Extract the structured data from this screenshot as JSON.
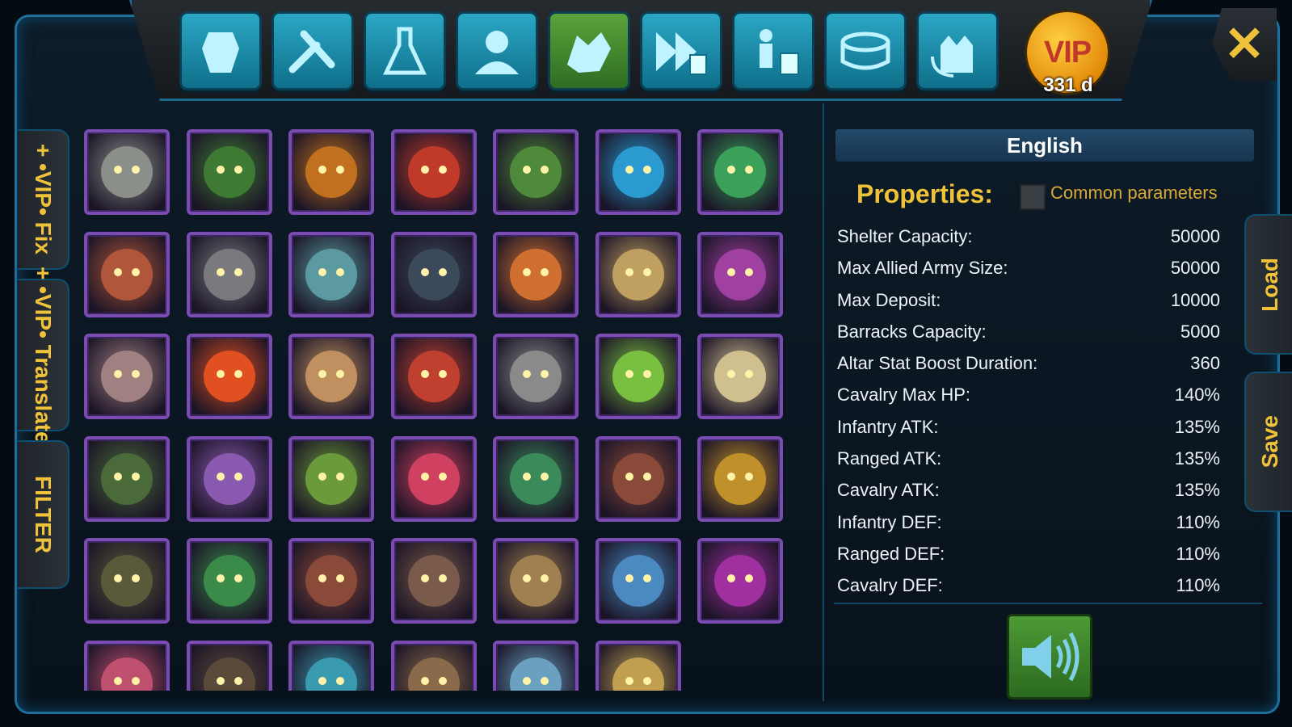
{
  "toolbar": {
    "buttons": [
      {
        "icon": "armor-icon",
        "active": false
      },
      {
        "icon": "tools-icon",
        "active": false
      },
      {
        "icon": "flask-icon",
        "active": false
      },
      {
        "icon": "user-icon",
        "active": false
      },
      {
        "icon": "dragon-icon",
        "active": true
      },
      {
        "icon": "fast-forward-calc-icon",
        "active": false
      },
      {
        "icon": "soldier-calc-icon",
        "active": false
      },
      {
        "icon": "arena-icon",
        "active": false
      },
      {
        "icon": "castle-refresh-icon",
        "active": false
      }
    ],
    "vip_label": "VIP",
    "vip_days": "331 d"
  },
  "side_tabs": {
    "vip_fix": "+ •VIP• Fix",
    "vip_translate": "+ •VIP• Translate",
    "filter": "FILTER",
    "load": "Load",
    "save": "Save"
  },
  "heroes": {
    "colors": [
      "#8a8f8a",
      "#3f7a34",
      "#c0701e",
      "#c03a2a",
      "#4f8a3a",
      "#2a9ad0",
      "#3aa05a",
      "#b0563a",
      "#7a7a7e",
      "#5a9aa0",
      "#3a4a5a",
      "#d07030",
      "#c0a060",
      "#a040a0",
      "#a08080",
      "#e05020",
      "#c09060",
      "#c04030",
      "#8a8a8a",
      "#7ac040",
      "#d0c090",
      "#4a6a3a",
      "#8a5ab0",
      "#6a9a3a",
      "#d04060",
      "#3a8a5a",
      "#8a4a3a",
      "#c0902a",
      "#5a5a3a",
      "#3a8a4a",
      "#8a4a3a",
      "#7a5a4a",
      "#a08050",
      "#4a8ac0",
      "#a030a0",
      "#c05070",
      "#5a4a3a",
      "#3a9ab0",
      "#8a6a4a",
      "#6aa0c0",
      "#c0a050"
    ]
  },
  "panel": {
    "language": "English",
    "properties_title": "Properties:",
    "common_params_label": "Common parameters",
    "rows": [
      {
        "k": "Shelter Capacity:",
        "v": "50000"
      },
      {
        "k": "Max Allied Army Size:",
        "v": "50000"
      },
      {
        "k": "Max Deposit:",
        "v": "10000"
      },
      {
        "k": "Barracks Capacity:",
        "v": "5000"
      },
      {
        "k": "Altar Stat Boost Duration:",
        "v": "360"
      },
      {
        "k": "Cavalry Max HP:",
        "v": "140%"
      },
      {
        "k": "Infantry ATK:",
        "v": "135%"
      },
      {
        "k": "Ranged ATK:",
        "v": "135%"
      },
      {
        "k": "Cavalry ATK:",
        "v": "135%"
      },
      {
        "k": "Infantry DEF:",
        "v": "110%"
      },
      {
        "k": "Ranged DEF:",
        "v": "110%"
      },
      {
        "k": "Cavalry DEF:",
        "v": "110%"
      }
    ]
  },
  "close_icon": "close-icon",
  "sound_icon": "speaker-icon"
}
